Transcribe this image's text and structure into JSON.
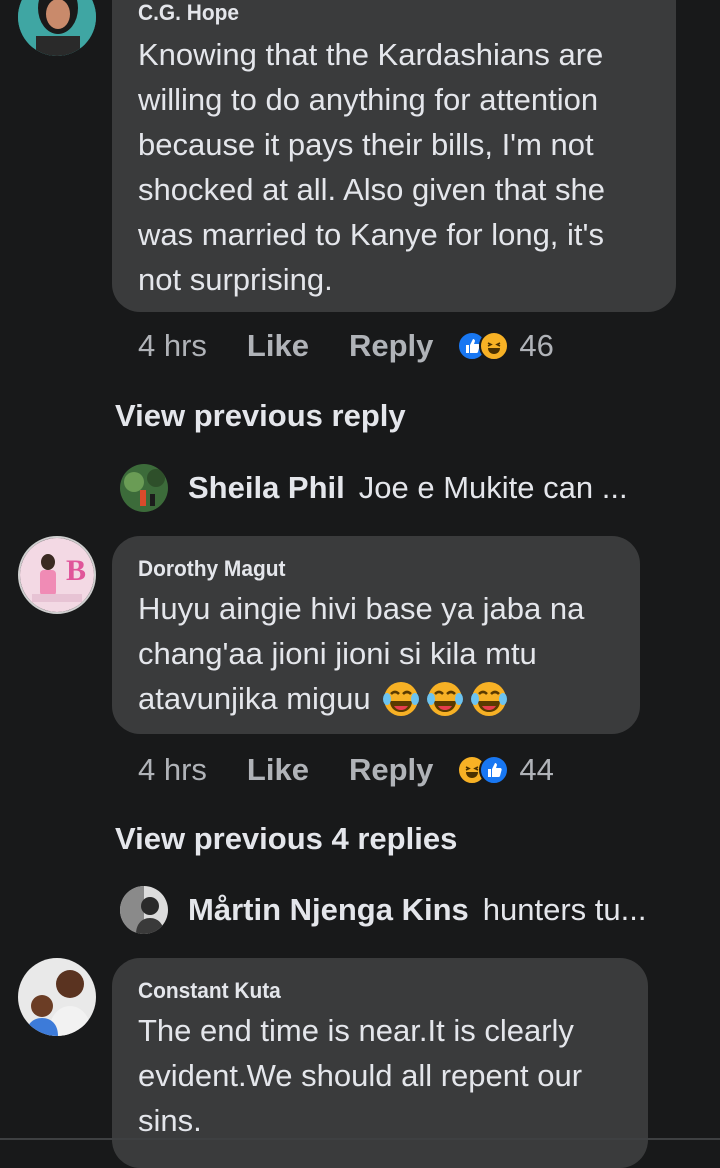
{
  "comments": [
    {
      "author": "C.G. Hope",
      "lines": [
        "Knowing that the Kardashians are",
        "willing to do anything for attention",
        "because it pays their bills, I'm not",
        "shocked at all. Also given that she",
        "was married to Kanye for long, it's",
        "not surprising."
      ],
      "time": "4 hrs",
      "like_label": "Like",
      "reply_label": "Reply",
      "reaction_icons": [
        "like-icon",
        "haha-icon"
      ],
      "reaction_count": "46",
      "view_previous": "View previous reply",
      "reply_preview": {
        "name": "Sheila Phil",
        "text": "Joe e Mukite can ..."
      }
    },
    {
      "author": "Dorothy Magut",
      "lines": [
        "Huyu aingie hivi base ya jaba na",
        "chang'aa jioni jioni si kila mtu",
        "atavunjika miguu"
      ],
      "emoji_trailer": [
        "tears-of-joy-icon",
        "tears-of-joy-icon",
        "tears-of-joy-icon"
      ],
      "time": "4 hrs",
      "like_label": "Like",
      "reply_label": "Reply",
      "reaction_icons": [
        "haha-icon",
        "like-icon"
      ],
      "reaction_count": "44",
      "view_previous": "View previous 4 replies",
      "reply_preview": {
        "name": "Mårtin Njenga Kins",
        "text": "hunters tu..."
      }
    },
    {
      "author": "Constant Kuta",
      "lines": [
        "The end time is near.It is clearly",
        "evident.We should all repent our",
        "sins."
      ]
    }
  ],
  "colors": {
    "background": "#18191a",
    "bubble": "#3a3b3c",
    "like_blue": "#1877f2",
    "haha_yellow": "#f7b125"
  }
}
